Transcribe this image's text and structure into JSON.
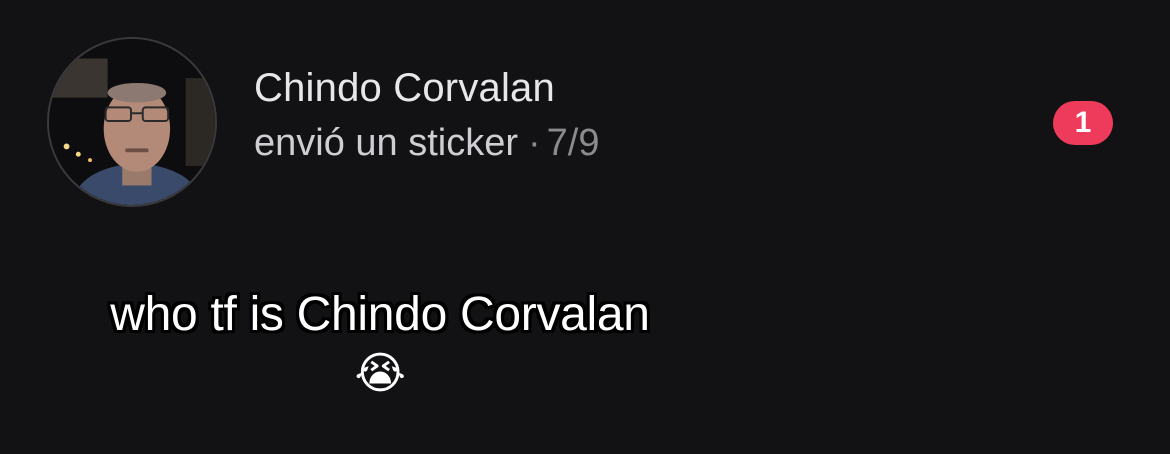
{
  "conversation": {
    "contact_name": "Chindo Corvalan",
    "preview_text": "envió un sticker",
    "separator": "·",
    "date": "7/9",
    "unread_count": "1"
  },
  "caption": {
    "text": "who tf is Chindo Corvalan",
    "emoji": "😭"
  },
  "colors": {
    "background": "#121113",
    "badge": "#ee3b5b",
    "name_text": "#e7e7ea",
    "secondary_text": "#8a8a8f"
  }
}
